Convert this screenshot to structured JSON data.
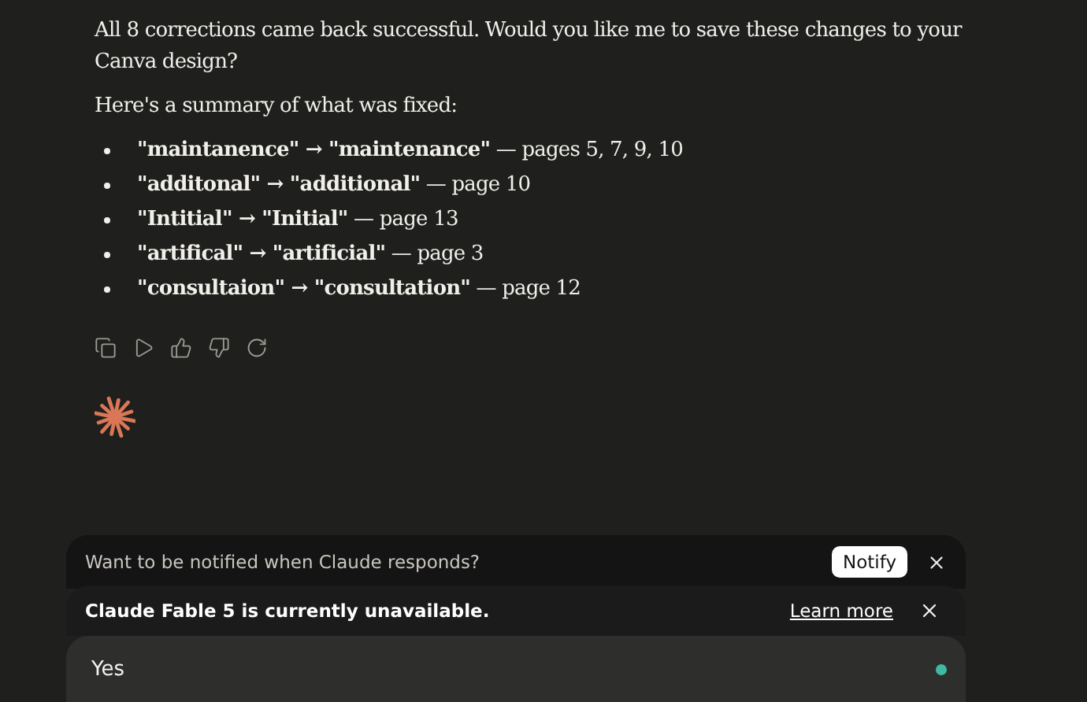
{
  "message": {
    "paragraphs": [
      "All 8 corrections came back successful. Would you like me to save these changes to your Canva design?",
      "Here's a summary of what was fixed:"
    ],
    "fixes": [
      "**\"maintanence\" → \"maintenance\"** — pages 5, 7, 9, 10",
      "**\"additonal\" → \"additional\"** — page 10",
      "**\"Intitial\" → \"Initial\"** — page 13",
      "**\"artifical\" → \"artificial\"** — page 3",
      "**\"consultaion\" → \"consultation\"** — page 12"
    ]
  },
  "actions": [
    {
      "kind": "copy"
    },
    {
      "kind": "play"
    },
    {
      "kind": "thumbs-up"
    },
    {
      "kind": "thumbs-down"
    },
    {
      "kind": "retry"
    }
  ],
  "notification": {
    "text": "Want to be notified when Claude responds?",
    "button": "Notify"
  },
  "banner": {
    "text": "Claude Fable 5 is currently unavailable.",
    "link": "Learn more"
  },
  "input": {
    "value": "Yes"
  }
}
